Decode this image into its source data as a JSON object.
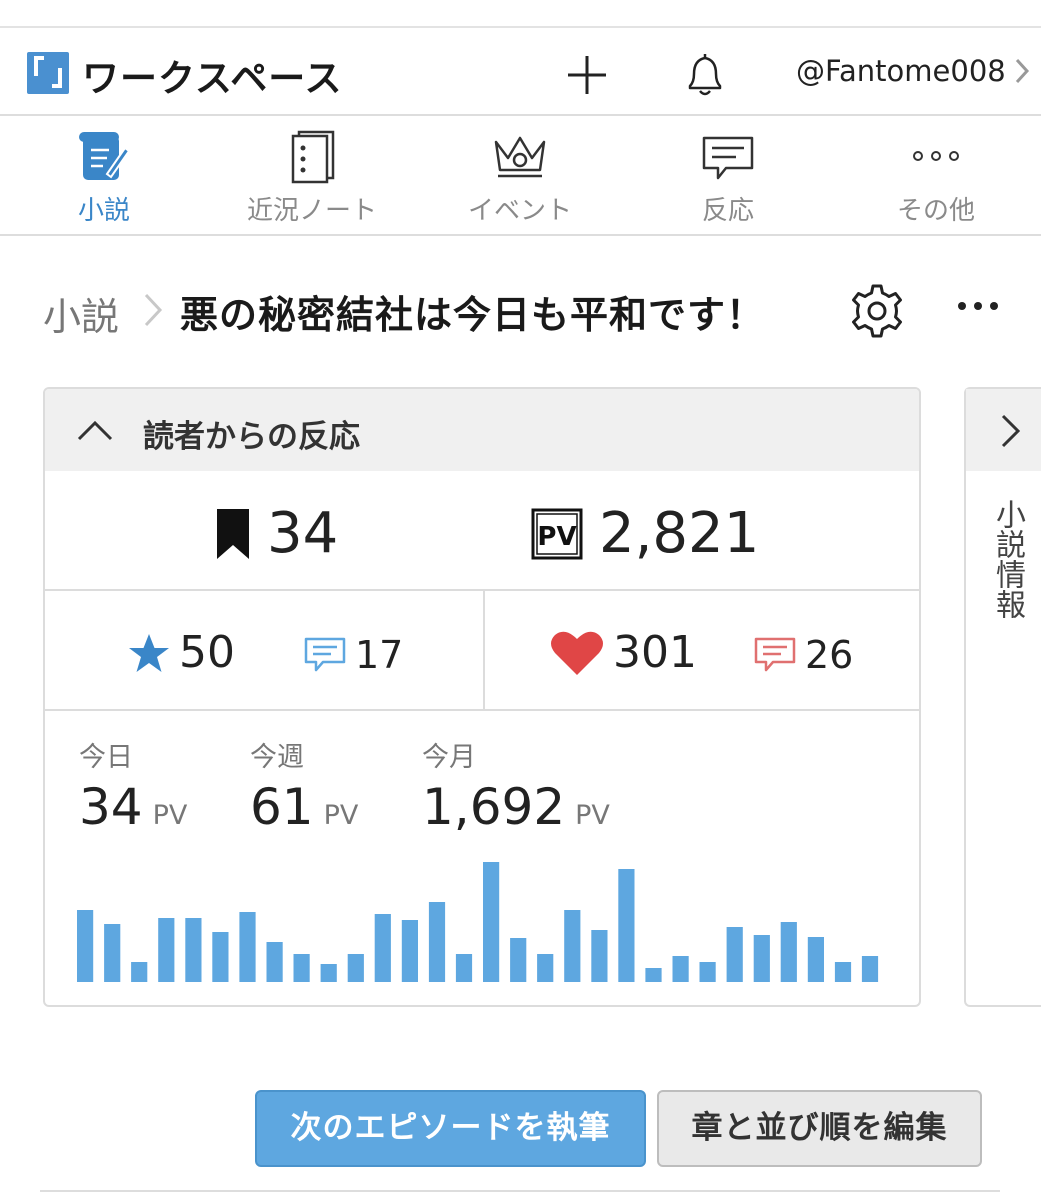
{
  "header": {
    "app_title": "ワークスペース",
    "user": "@Fantome008"
  },
  "tabs": [
    {
      "label": "小説",
      "icon": "scroll-pen-icon",
      "active": true
    },
    {
      "label": "近況ノート",
      "icon": "notebook-icon",
      "active": false
    },
    {
      "label": "イベント",
      "icon": "crown-icon",
      "active": false
    },
    {
      "label": "反応",
      "icon": "comment-icon",
      "active": false
    },
    {
      "label": "その他",
      "icon": "dots-icon",
      "active": false
    }
  ],
  "breadcrumb": {
    "root": "小説",
    "title": "悪の秘密結社は今日も平和です！"
  },
  "reactions": {
    "title": "読者からの反応",
    "bookmarks": "34",
    "pv_total": "2,821",
    "stars": "50",
    "star_comments": "17",
    "hearts": "301",
    "heart_comments": "26",
    "today_label": "今日",
    "today_value": "34",
    "week_label": "今週",
    "week_value": "61",
    "month_label": "今月",
    "month_value": "1,692",
    "unit": "PV"
  },
  "chart_data": {
    "type": "bar",
    "values": [
      72,
      58,
      20,
      64,
      64,
      50,
      70,
      40,
      28,
      18,
      28,
      68,
      62,
      80,
      28,
      120,
      44,
      28,
      72,
      52,
      113,
      14,
      26,
      20,
      55,
      47,
      60,
      45,
      20,
      26
    ],
    "color": "#5ea7e0"
  },
  "side_panel": {
    "label": "小説情報"
  },
  "actions": {
    "write_next": "次のエピソードを執筆",
    "edit_order": "章と並び順を編集"
  },
  "colors": {
    "accent": "#3a86c8",
    "star": "#3a86c8",
    "heart": "#e04646",
    "bar": "#5ea7e0"
  }
}
